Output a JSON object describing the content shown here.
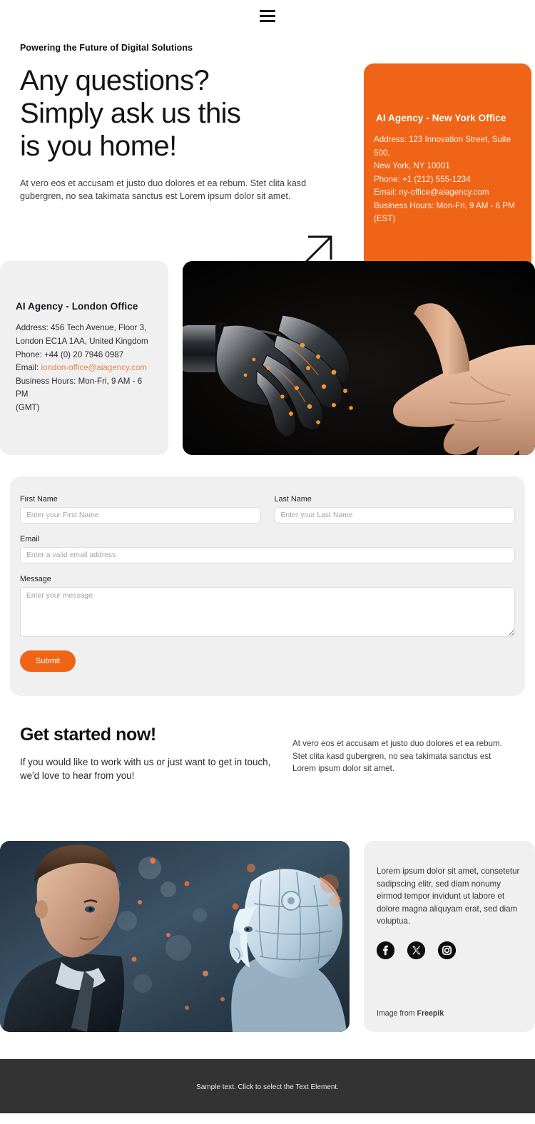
{
  "header": {
    "menu_icon": "hamburger-menu-icon"
  },
  "hero": {
    "eyebrow": "Powering the Future of Digital Solutions",
    "title_line1": "Any questions?",
    "title_line2": "Simply ask us this",
    "title_line3": "is you home!",
    "paragraph": "At vero eos et accusam et justo duo dolores et ea rebum. Stet clita kasd gubergren, no sea takimata sanctus est Lorem ipsum dolor sit amet.",
    "arrow_icon": "arrow-up-right-icon"
  },
  "ny_office": {
    "title": "AI Agency - New York Office",
    "address_line1": "Address: 123 Innovation Street, Suite 500,",
    "address_line2": "New York, NY 10001",
    "phone": "Phone: +1 (212) 555-1234",
    "email": "Email: ny-office@aiagency.com",
    "hours_line1": "Business Hours: Mon-Fri, 9 AM - 6 PM",
    "hours_line2": "(EST)",
    "bg_color": "#ef6417"
  },
  "london_office": {
    "title": "AI Agency - London Office",
    "address_line1": "Address: 456 Tech Avenue, Floor 3,",
    "address_line2": "London EC1A 1AA, United Kingdom",
    "phone": "Phone: +44 (0) 20 7946 0987",
    "email_label": "Email:",
    "email_value": "london-office@aiagency.com",
    "email_color": "#e4884f",
    "hours_line1": "Business Hours: Mon-Fri, 9 AM - 6 PM",
    "hours_line2": "(GMT)",
    "bg_color": "#f0f0f0"
  },
  "hands_image": {
    "alt": "robotic hand reaching toward human hand on black background"
  },
  "form": {
    "first_name": {
      "label": "First Name",
      "placeholder": "Enter your First Name",
      "value": ""
    },
    "last_name": {
      "label": "Last Name",
      "placeholder": "Enter your Last Name",
      "value": ""
    },
    "email": {
      "label": "Email",
      "placeholder": "Enter a valid email address",
      "value": ""
    },
    "message": {
      "label": "Message",
      "placeholder": "Enter your message",
      "value": ""
    },
    "submit_label": "Submit",
    "submit_color": "#ef6417"
  },
  "cta": {
    "title": "Get started now!",
    "subtitle": "If you would like to work with us or just want to get in touch, we'd love to hear from you!",
    "paragraph": "At vero eos et accusam et justo duo dolores et ea rebum. Stet clita kasd gubergren, no sea takimata sanctus est Lorem ipsum dolor sit amet."
  },
  "ai_image": {
    "alt": "businessman facing a humanoid robot with bokeh background"
  },
  "info_card": {
    "paragraph": "Lorem ipsum dolor sit amet, consetetur sadipscing elitr, sed diam nonumy eirmod tempor invidunt ut labore et dolore magna aliquyam erat, sed diam voluptua.",
    "socials": [
      {
        "name": "facebook-icon"
      },
      {
        "name": "x-twitter-icon"
      },
      {
        "name": "instagram-icon"
      }
    ],
    "credit_prefix": "Image from ",
    "credit_source": "Freepik"
  },
  "footer": {
    "text": "Sample text. Click to select the Text Element.",
    "bg_color": "#333333"
  }
}
